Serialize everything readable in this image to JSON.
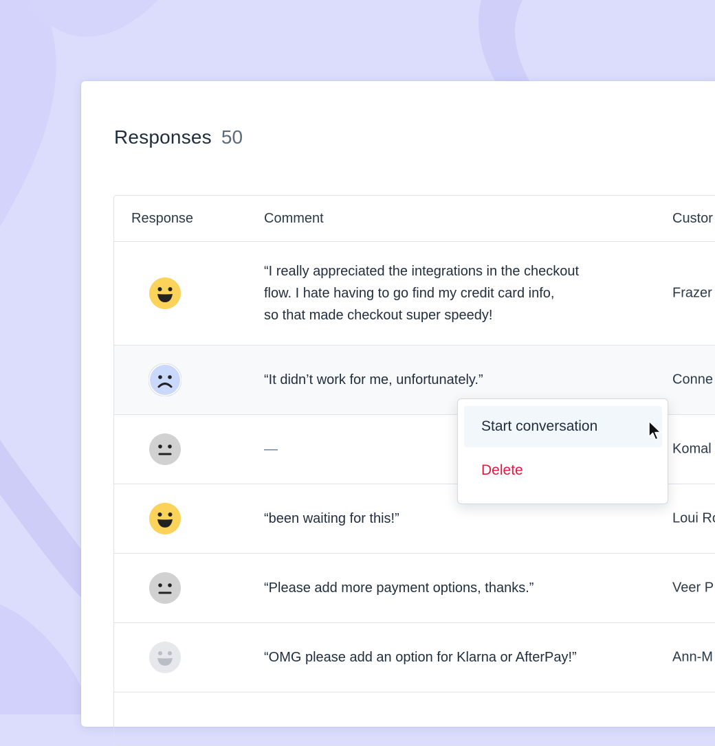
{
  "header": {
    "title": "Responses",
    "count": "50"
  },
  "table": {
    "columns": [
      "Response",
      "Comment",
      "Custor"
    ],
    "rows": [
      {
        "sentiment": "happy",
        "comment": "“I really appreciated the integrations in the checkout\nflow. I hate having to go find my credit card info,\nso that made checkout super speedy!",
        "customer": "Frazer"
      },
      {
        "sentiment": "sad",
        "comment": "“It didn’t work for me, unfortunately.”",
        "customer": "Conne"
      },
      {
        "sentiment": "neutral",
        "comment": "—",
        "customer": "Komal"
      },
      {
        "sentiment": "happy",
        "comment": "“been waiting for this!”",
        "customer": "Loui Ro"
      },
      {
        "sentiment": "neutral",
        "comment": "“Please add more payment options, thanks.”",
        "customer": "Veer P"
      },
      {
        "sentiment": "faded-happy",
        "comment": "“OMG please add an option for Klarna or AfterPay!”",
        "customer": "Ann-M"
      }
    ]
  },
  "context_menu": {
    "items": [
      {
        "label": "Start conversation"
      },
      {
        "label": "Delete"
      }
    ]
  },
  "colors": {
    "background": "#dcdcfc",
    "happy_face": "#fbd25a",
    "sad_face": "#c9d8fb",
    "neutral_face": "#d1d1d1",
    "faded_face": "#e6e8ec",
    "delete": "#e5173f"
  },
  "icons": [
    "grinning-face-icon",
    "frowning-face-icon",
    "neutral-face-icon",
    "pointer-cursor-icon"
  ]
}
